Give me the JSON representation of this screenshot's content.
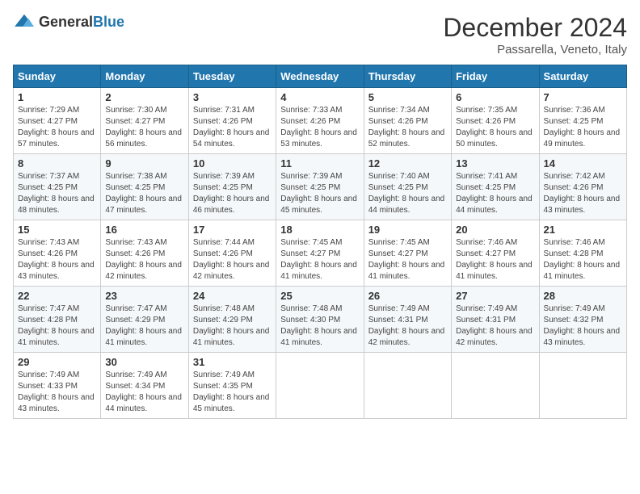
{
  "logo": {
    "general": "General",
    "blue": "Blue"
  },
  "header": {
    "month": "December 2024",
    "location": "Passarella, Veneto, Italy"
  },
  "weekdays": [
    "Sunday",
    "Monday",
    "Tuesday",
    "Wednesday",
    "Thursday",
    "Friday",
    "Saturday"
  ],
  "weeks": [
    [
      {
        "day": "1",
        "sunrise": "7:29 AM",
        "sunset": "4:27 PM",
        "daylight": "8 hours and 57 minutes."
      },
      {
        "day": "2",
        "sunrise": "7:30 AM",
        "sunset": "4:27 PM",
        "daylight": "8 hours and 56 minutes."
      },
      {
        "day": "3",
        "sunrise": "7:31 AM",
        "sunset": "4:26 PM",
        "daylight": "8 hours and 54 minutes."
      },
      {
        "day": "4",
        "sunrise": "7:33 AM",
        "sunset": "4:26 PM",
        "daylight": "8 hours and 53 minutes."
      },
      {
        "day": "5",
        "sunrise": "7:34 AM",
        "sunset": "4:26 PM",
        "daylight": "8 hours and 52 minutes."
      },
      {
        "day": "6",
        "sunrise": "7:35 AM",
        "sunset": "4:26 PM",
        "daylight": "8 hours and 50 minutes."
      },
      {
        "day": "7",
        "sunrise": "7:36 AM",
        "sunset": "4:25 PM",
        "daylight": "8 hours and 49 minutes."
      }
    ],
    [
      {
        "day": "8",
        "sunrise": "7:37 AM",
        "sunset": "4:25 PM",
        "daylight": "8 hours and 48 minutes."
      },
      {
        "day": "9",
        "sunrise": "7:38 AM",
        "sunset": "4:25 PM",
        "daylight": "8 hours and 47 minutes."
      },
      {
        "day": "10",
        "sunrise": "7:39 AM",
        "sunset": "4:25 PM",
        "daylight": "8 hours and 46 minutes."
      },
      {
        "day": "11",
        "sunrise": "7:39 AM",
        "sunset": "4:25 PM",
        "daylight": "8 hours and 45 minutes."
      },
      {
        "day": "12",
        "sunrise": "7:40 AM",
        "sunset": "4:25 PM",
        "daylight": "8 hours and 44 minutes."
      },
      {
        "day": "13",
        "sunrise": "7:41 AM",
        "sunset": "4:25 PM",
        "daylight": "8 hours and 44 minutes."
      },
      {
        "day": "14",
        "sunrise": "7:42 AM",
        "sunset": "4:26 PM",
        "daylight": "8 hours and 43 minutes."
      }
    ],
    [
      {
        "day": "15",
        "sunrise": "7:43 AM",
        "sunset": "4:26 PM",
        "daylight": "8 hours and 43 minutes."
      },
      {
        "day": "16",
        "sunrise": "7:43 AM",
        "sunset": "4:26 PM",
        "daylight": "8 hours and 42 minutes."
      },
      {
        "day": "17",
        "sunrise": "7:44 AM",
        "sunset": "4:26 PM",
        "daylight": "8 hours and 42 minutes."
      },
      {
        "day": "18",
        "sunrise": "7:45 AM",
        "sunset": "4:27 PM",
        "daylight": "8 hours and 41 minutes."
      },
      {
        "day": "19",
        "sunrise": "7:45 AM",
        "sunset": "4:27 PM",
        "daylight": "8 hours and 41 minutes."
      },
      {
        "day": "20",
        "sunrise": "7:46 AM",
        "sunset": "4:27 PM",
        "daylight": "8 hours and 41 minutes."
      },
      {
        "day": "21",
        "sunrise": "7:46 AM",
        "sunset": "4:28 PM",
        "daylight": "8 hours and 41 minutes."
      }
    ],
    [
      {
        "day": "22",
        "sunrise": "7:47 AM",
        "sunset": "4:28 PM",
        "daylight": "8 hours and 41 minutes."
      },
      {
        "day": "23",
        "sunrise": "7:47 AM",
        "sunset": "4:29 PM",
        "daylight": "8 hours and 41 minutes."
      },
      {
        "day": "24",
        "sunrise": "7:48 AM",
        "sunset": "4:29 PM",
        "daylight": "8 hours and 41 minutes."
      },
      {
        "day": "25",
        "sunrise": "7:48 AM",
        "sunset": "4:30 PM",
        "daylight": "8 hours and 41 minutes."
      },
      {
        "day": "26",
        "sunrise": "7:49 AM",
        "sunset": "4:31 PM",
        "daylight": "8 hours and 42 minutes."
      },
      {
        "day": "27",
        "sunrise": "7:49 AM",
        "sunset": "4:31 PM",
        "daylight": "8 hours and 42 minutes."
      },
      {
        "day": "28",
        "sunrise": "7:49 AM",
        "sunset": "4:32 PM",
        "daylight": "8 hours and 43 minutes."
      }
    ],
    [
      {
        "day": "29",
        "sunrise": "7:49 AM",
        "sunset": "4:33 PM",
        "daylight": "8 hours and 43 minutes."
      },
      {
        "day": "30",
        "sunrise": "7:49 AM",
        "sunset": "4:34 PM",
        "daylight": "8 hours and 44 minutes."
      },
      {
        "day": "31",
        "sunrise": "7:49 AM",
        "sunset": "4:35 PM",
        "daylight": "8 hours and 45 minutes."
      },
      null,
      null,
      null,
      null
    ]
  ],
  "labels": {
    "sunrise": "Sunrise: ",
    "sunset": "Sunset: ",
    "daylight": "Daylight: "
  }
}
